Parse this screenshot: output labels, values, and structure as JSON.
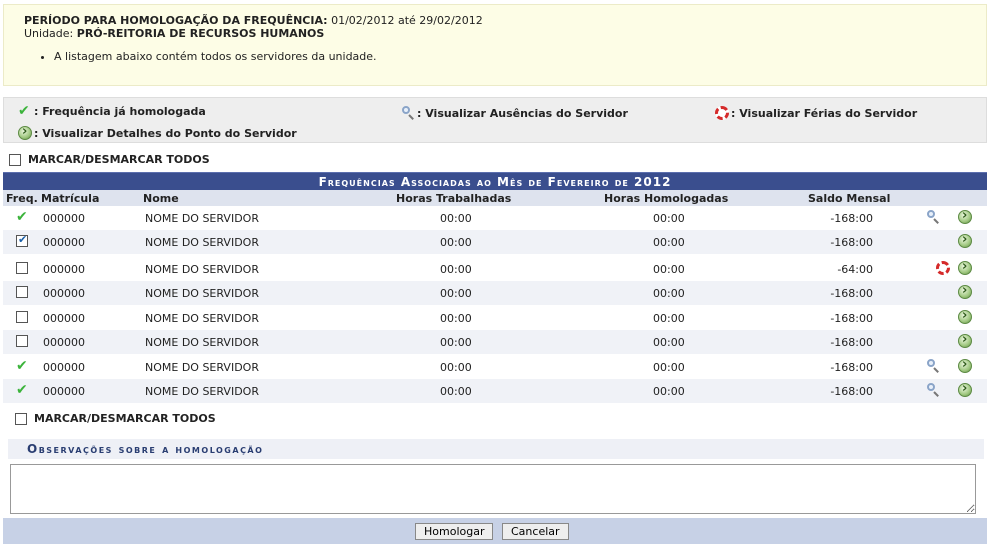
{
  "info": {
    "period_label": "PERÍODO PARA HOMOLOGAÇÃO DA FREQUÊNCIA:",
    "period_value": "01/02/2012 até 29/02/2012",
    "unit_label": "Unidade:",
    "unit_value": "PRÓ-REITORIA DE RECURSOS HUMANOS",
    "note": "A listagem abaixo contém todos os servidores da unidade."
  },
  "legend": {
    "homologated": ": Frequência já homologada",
    "absences": ": Visualizar Ausências do Servidor",
    "vacations": ": Visualizar Férias do Servidor",
    "details": ": Visualizar Detalhes do Ponto do Servidor"
  },
  "mark_all_label": "MARCAR/DESMARCAR TODOS",
  "table": {
    "caption": "Frequências Associadas ao Mês de Fevereiro de 2012",
    "headers": {
      "freq": "Freq.",
      "matricula": "Matrícula",
      "nome": "Nome",
      "horas_trabalhadas": "Horas Trabalhadas",
      "horas_homologadas": "Horas Homologadas",
      "saldo": "Saldo Mensal"
    },
    "rows": [
      {
        "status": "homologated",
        "matricula": "000000",
        "nome": "NOME DO SERVIDOR",
        "trabalhadas": "00:00",
        "homologadas": "00:00",
        "saldo": "-168:00",
        "action_icon": "magnifier-icon"
      },
      {
        "status": "checked",
        "matricula": "000000",
        "nome": "NOME DO SERVIDOR",
        "trabalhadas": "00:00",
        "homologadas": "00:00",
        "saldo": "-168:00",
        "action_icon": ""
      },
      {
        "status": "unchecked",
        "matricula": "000000",
        "nome": "NOME DO SERVIDOR",
        "trabalhadas": "00:00",
        "homologadas": "00:00",
        "saldo": "-64:00",
        "action_icon": "lifebuoy-icon"
      },
      {
        "status": "unchecked",
        "matricula": "000000",
        "nome": "NOME DO SERVIDOR",
        "trabalhadas": "00:00",
        "homologadas": "00:00",
        "saldo": "-168:00",
        "action_icon": ""
      },
      {
        "status": "unchecked",
        "matricula": "000000",
        "nome": "NOME DO SERVIDOR",
        "trabalhadas": "00:00",
        "homologadas": "00:00",
        "saldo": "-168:00",
        "action_icon": ""
      },
      {
        "status": "unchecked",
        "matricula": "000000",
        "nome": "NOME DO SERVIDOR",
        "trabalhadas": "00:00",
        "homologadas": "00:00",
        "saldo": "-168:00",
        "action_icon": ""
      },
      {
        "status": "homologated",
        "matricula": "000000",
        "nome": "NOME DO SERVIDOR",
        "trabalhadas": "00:00",
        "homologadas": "00:00",
        "saldo": "-168:00",
        "action_icon": "magnifier-icon"
      },
      {
        "status": "homologated",
        "matricula": "000000",
        "nome": "NOME DO SERVIDOR",
        "trabalhadas": "00:00",
        "homologadas": "00:00",
        "saldo": "-168:00",
        "action_icon": "magnifier-icon"
      }
    ]
  },
  "observations": {
    "header": "Observações sobre a homologação",
    "value": ""
  },
  "buttons": {
    "submit": "Homologar",
    "cancel": "Cancelar"
  }
}
